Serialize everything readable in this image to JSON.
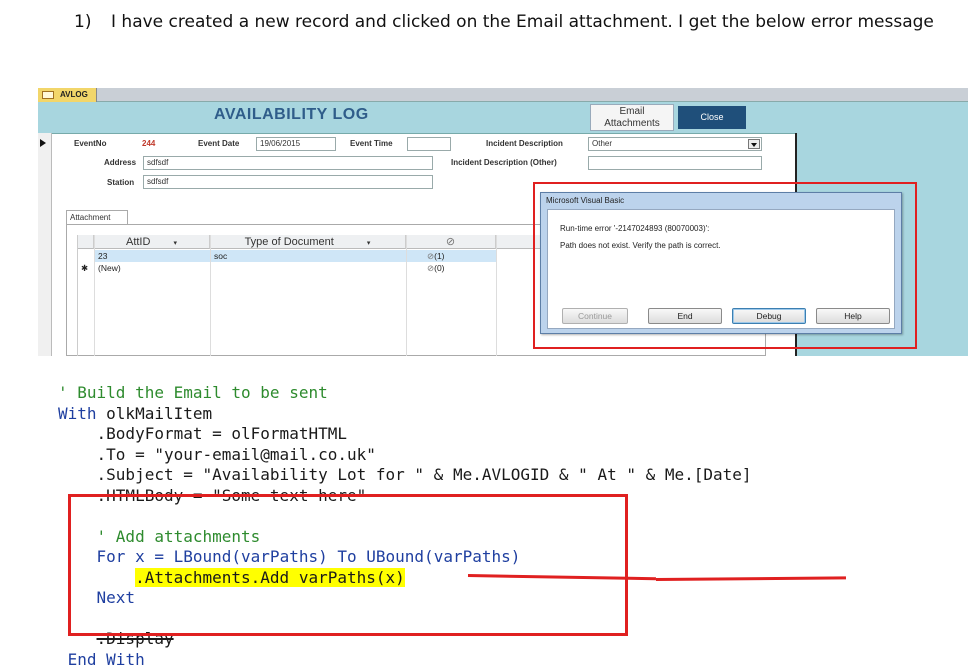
{
  "intro": {
    "number": "1)",
    "text": "I have created a new record and clicked on the Email attachment.  I get the below error message"
  },
  "access": {
    "doc_tab": "AVLOG",
    "form_title": "AVAILABILITY LOG",
    "email_button": "Email Attachments",
    "close_button": "Close",
    "fields": {
      "event_no_label": "EventNo",
      "event_no_value": "244",
      "event_date_label": "Event Date",
      "event_date_value": "19/06/2015",
      "event_time_label": "Event Time",
      "event_time_value": "",
      "incident_desc_label": "Incident Description",
      "incident_desc_value": "Other",
      "incident_desc_other_label": "Incident Description (Other)",
      "incident_desc_other_value": "",
      "address_label": "Address",
      "address_value": "sdfsdf",
      "station_label": "Station",
      "station_value": "sdfsdf"
    },
    "attachment_tab": "Attachment",
    "grid": {
      "columns": [
        "AttID",
        "Type of Document",
        "⊘"
      ],
      "rows": [
        {
          "selector": "",
          "att_id": "23",
          "type": "soc",
          "count": "(1)"
        },
        {
          "selector": "✱",
          "att_id": "(New)",
          "type": "",
          "count": "(0)"
        }
      ]
    }
  },
  "dialog": {
    "title": "Microsoft Visual Basic",
    "error": "Run-time error '-2147024893 (80070003)':",
    "message": "Path does not exist. Verify the path is correct.",
    "buttons": {
      "continue": "Continue",
      "end": "End",
      "debug": "Debug",
      "help": "Help"
    }
  },
  "code": {
    "lines": [
      {
        "pre": "",
        "a": "' Build the Email to be sent",
        "b": ""
      },
      {
        "pre": "",
        "a": "With",
        "b": " olkMailItem"
      },
      {
        "pre": "    ",
        "a": ".BodyFormat = olFormatHTML",
        "b": ""
      },
      {
        "pre": "    ",
        "a": ".To = \"your-email@mail.co.uk\"",
        "b": ""
      },
      {
        "pre": "    ",
        "a": ".Subject = \"Availability Lot for \" & Me.AVLOGID & \" At \" & Me.[Date]",
        "b": ""
      },
      {
        "pre": "    ",
        "a": ".HTMLBody = \"Some text here\"",
        "b": ""
      },
      {
        "pre": "",
        "a": "",
        "b": ""
      },
      {
        "pre": "    ",
        "a": "' Add attachments",
        "b": ""
      },
      {
        "pre": "    ",
        "a": "For",
        "b": " x = LBound(varPaths) To UBound(varPaths)"
      },
      {
        "pre": "        ",
        "a": ".Attachments.Add varPaths(x)",
        "b": ""
      },
      {
        "pre": "    ",
        "a": "Next",
        "b": ""
      },
      {
        "pre": "",
        "a": "",
        "b": ""
      },
      {
        "pre": "    ",
        "a": ".Display",
        "b": ""
      },
      {
        "pre": " ",
        "a": "End With",
        "b": ""
      }
    ]
  }
}
